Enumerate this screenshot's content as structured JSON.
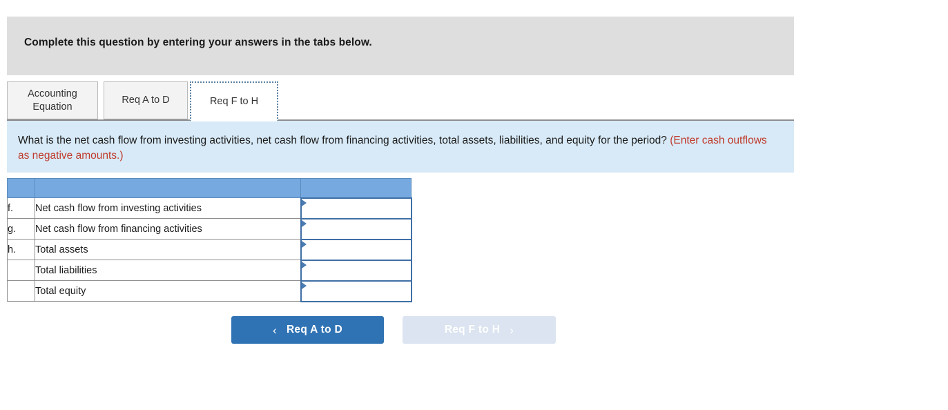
{
  "instruction": {
    "text": "Complete this question by entering your answers in the tabs below."
  },
  "tabs": [
    {
      "id": "accounting-equation",
      "label": "Accounting Equation",
      "active": false
    },
    {
      "id": "req-a-to-d",
      "label": "Req A to D",
      "active": false
    },
    {
      "id": "req-f-to-h",
      "label": "Req F to H",
      "active": true
    }
  ],
  "question": {
    "main": "What is the net cash flow from investing activities, net cash flow from financing activities, total assets, liabilities, and equity for the period?",
    "note": "(Enter cash outflows as negative amounts.)"
  },
  "table": {
    "headers": [
      "",
      "",
      ""
    ],
    "rows": [
      {
        "key": "f.",
        "description": "Net cash flow from investing activities",
        "value": ""
      },
      {
        "key": "g.",
        "description": "Net cash flow from financing activities",
        "value": ""
      },
      {
        "key": "h.",
        "description": "Total assets",
        "value": ""
      },
      {
        "key": "",
        "description": "Total liabilities",
        "value": ""
      },
      {
        "key": "",
        "description": "Total equity",
        "value": ""
      }
    ]
  },
  "navigation": {
    "prev_label": "Req A to D",
    "prev_chevron": "chevron-left-icon",
    "prev_glyph": "‹",
    "next_label": "Req F to H",
    "next_chevron": "chevron-right-icon",
    "next_glyph": "›",
    "next_disabled": true
  },
  "colors": {
    "instruction_bar": "#dedede",
    "banner_bg": "#d8eaf7",
    "table_header_blue": "#76a9df",
    "input_border_blue": "#3f6fa5",
    "marker_blue": "#4a7cb3",
    "primary_button": "#3073b4",
    "disabled_button": "#dbe4f0",
    "note_red": "#c0392b"
  }
}
